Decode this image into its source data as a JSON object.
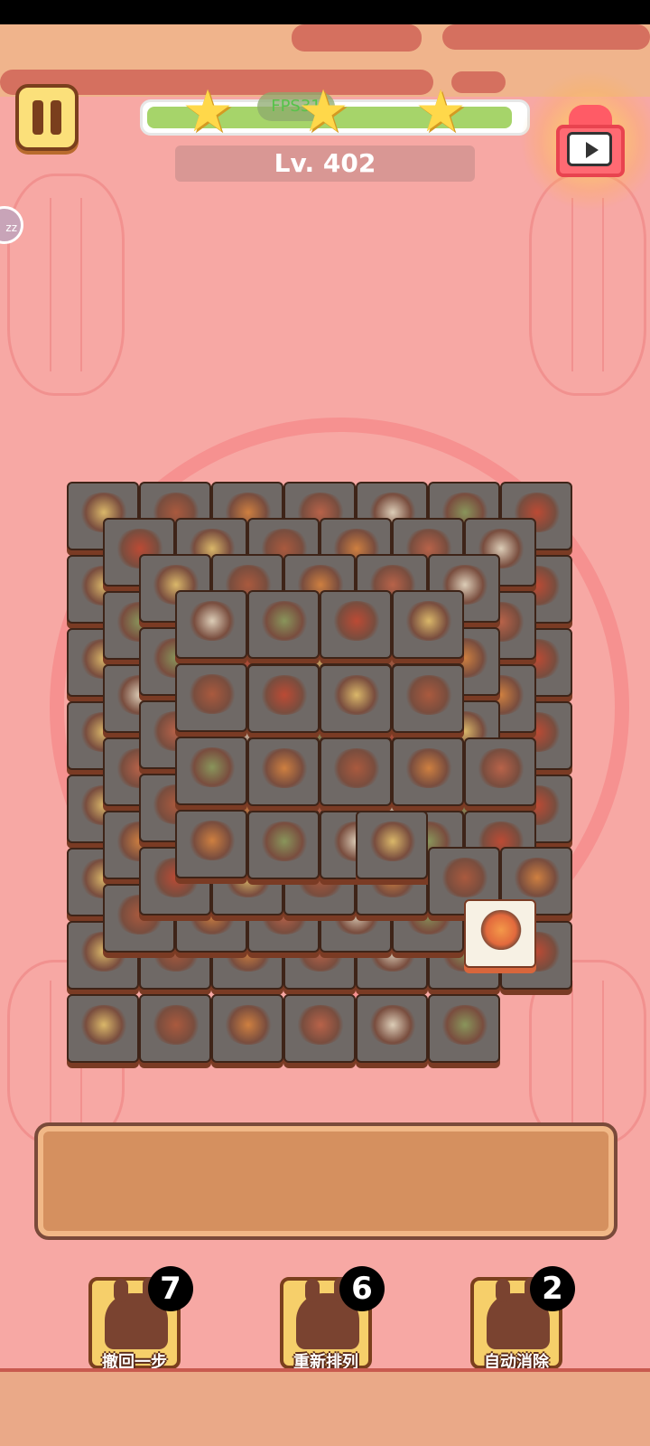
{
  "hud": {
    "fps_label": "FPS31",
    "level_label": "Lv. 402",
    "stars_total": 3,
    "progress_fraction": 0.97
  },
  "icons": {
    "pause": "pause-icon",
    "star": "star-icon",
    "gift": "video-gift-icon"
  },
  "board": {
    "active_tile_food": "clay-pot-stew",
    "tile_count_visible": 92
  },
  "tools": [
    {
      "label": "撤回一步",
      "count": "7"
    },
    {
      "label": "重新排列",
      "count": "6"
    },
    {
      "label": "自动消除",
      "count": "2"
    }
  ],
  "colors": {
    "background": "#f7a8a4",
    "tile_dark": "#6f6966",
    "tile_active": "#f7f1e4",
    "tray": "#d5905f",
    "progress": "#a6d46a"
  }
}
